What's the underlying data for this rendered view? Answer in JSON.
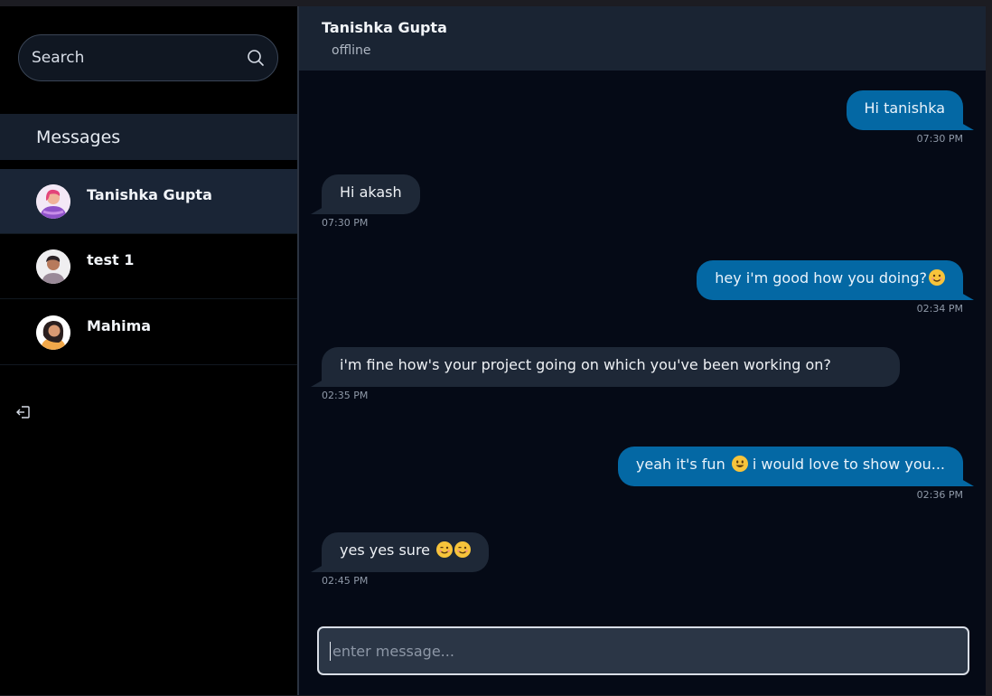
{
  "sidebar": {
    "search": {
      "placeholder": "Search",
      "icon": "search-icon"
    },
    "heading": "Messages",
    "contacts": [
      {
        "name": "Tanishka Gupta",
        "active": true
      },
      {
        "name": "test 1",
        "active": false
      },
      {
        "name": "Mahima",
        "active": false
      }
    ],
    "logout_icon": "logout-icon"
  },
  "chat": {
    "contact_name": "Tanishka Gupta",
    "status": "offline",
    "messages": [
      {
        "direction": "out",
        "text": "Hi tanishka",
        "time": "07:30 PM"
      },
      {
        "direction": "in",
        "text": "Hi akash",
        "time": "07:30 PM"
      },
      {
        "direction": "out",
        "text": "hey i'm good how you doing?",
        "emoji": [
          "smiling-face"
        ],
        "time": "02:34 PM"
      },
      {
        "direction": "in",
        "text": "i'm fine how's your project going on which you've been working on?",
        "time": "02:35 PM"
      },
      {
        "direction": "out",
        "text_before": "yeah it's fun",
        "emoji": [
          "grinning-face"
        ],
        "text_after": "i would love to show you...",
        "time": "02:36 PM"
      },
      {
        "direction": "in",
        "text": "yes yes sure",
        "emoji": [
          "winking-face",
          "winking-face"
        ],
        "time": "02:45 PM"
      }
    ],
    "composer": {
      "placeholder": "enter message..."
    }
  },
  "colors": {
    "outgoing_bubble": "#0468a4",
    "incoming_bubble": "#1e2837",
    "chat_background": "#050a16",
    "header_background": "#1a2433",
    "active_contact": "#1a2536"
  }
}
